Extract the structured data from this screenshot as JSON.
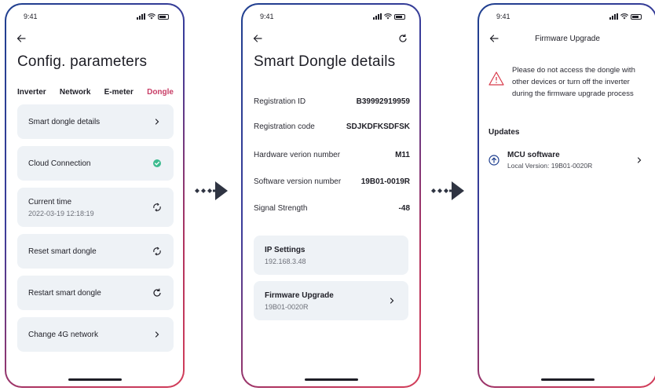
{
  "status": {
    "time": "9:41"
  },
  "colors": {
    "accent": "#c83d66",
    "card_bg": "#eef2f6",
    "success": "#3dbb8f",
    "warning": "#d83a4a",
    "arrow": "#2f3442"
  },
  "screen1": {
    "title": "Config. parameters",
    "tabs": [
      "Inverter",
      "Network",
      "E-meter",
      "Dongle"
    ],
    "active_tab": "Dongle",
    "cards": [
      {
        "label": "Smart dongle details",
        "icon": "chevron-right-icon"
      },
      {
        "label": "Cloud Connection",
        "icon": "check-circle-icon"
      },
      {
        "label": "Current time",
        "sub": "2022-03-19 12:18:19",
        "icon": "sync-icon"
      },
      {
        "label": "Reset smart dongle",
        "icon": "sync-icon"
      },
      {
        "label": "Restart smart dongle",
        "icon": "refresh-icon"
      },
      {
        "label": "Change 4G network",
        "icon": "chevron-right-icon"
      }
    ]
  },
  "screen2": {
    "title": "Smart Dongle details",
    "fields": [
      {
        "label": "Registration ID",
        "value": "B39992919959"
      },
      {
        "label": "Registration code",
        "value": "SDJKDFKSDFSK"
      },
      {
        "label": "Hardware verion number",
        "value": "M11"
      },
      {
        "label": "Software version number",
        "value": "19B01-0019R"
      },
      {
        "label": "Signal Strength",
        "value": "-48"
      }
    ],
    "ip_settings": {
      "title": "IP Settings",
      "value": "192.168.3.48"
    },
    "firmware": {
      "title": "Firmware Upgrade",
      "value": "19B01-0020R"
    }
  },
  "screen3": {
    "title": "Firmware Upgrade",
    "warning": "Please do not access the dongle with other devices or turn off the inverter during the firmware upgrade process",
    "updates_heading": "Updates",
    "item": {
      "title": "MCU software",
      "sub": "Local Version: 19B01-0020R"
    }
  }
}
